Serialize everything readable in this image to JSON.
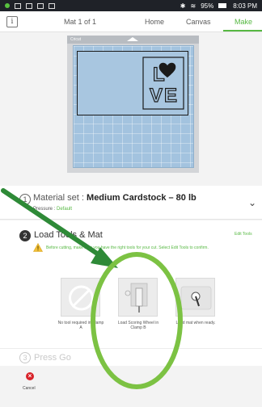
{
  "status_bar": {
    "right_text": "95%",
    "time": "8:03 PM",
    "icons": [
      "notification-dot",
      "message-icon",
      "alert-icon",
      "download-icon",
      "image-icon",
      "bluetooth-icon",
      "wifi-icon",
      "battery-icon"
    ]
  },
  "tabbar": {
    "info_label": "i",
    "mat_label": "Mat 1 of 1",
    "tabs": [
      "Home",
      "Canvas",
      "Make"
    ],
    "active_tab": "Make",
    "accent_color": "#56b842"
  },
  "mat_preview": {
    "brand": "Cricut",
    "design_text": [
      "L",
      "O",
      "V",
      "E"
    ]
  },
  "material": {
    "step": "1",
    "prefix": "Material set :",
    "name": "Medium Cardstock – 80 lb",
    "pressure_label": "Pressure :",
    "pressure_value": "Default"
  },
  "tools": {
    "step": "2",
    "title": "Load Tools & Mat",
    "edit_tools": "Edit Tools",
    "warning": "Before cutting, make sure you have the right tools for your cut. Select Edit Tools to confirm.",
    "cards": [
      {
        "caption": "No tool required in Clamp A"
      },
      {
        "caption": "Load Scoring Wheel in Clamp B"
      },
      {
        "caption": "Load mat when ready."
      }
    ]
  },
  "press_go": {
    "step": "3",
    "label": "Press Go"
  },
  "cancel": {
    "icon_glyph": "×",
    "label": "Cancel",
    "color": "#d8232a"
  },
  "annotation": {
    "arrow_color": "#2e8a37",
    "circle_color": "#7cc243"
  }
}
